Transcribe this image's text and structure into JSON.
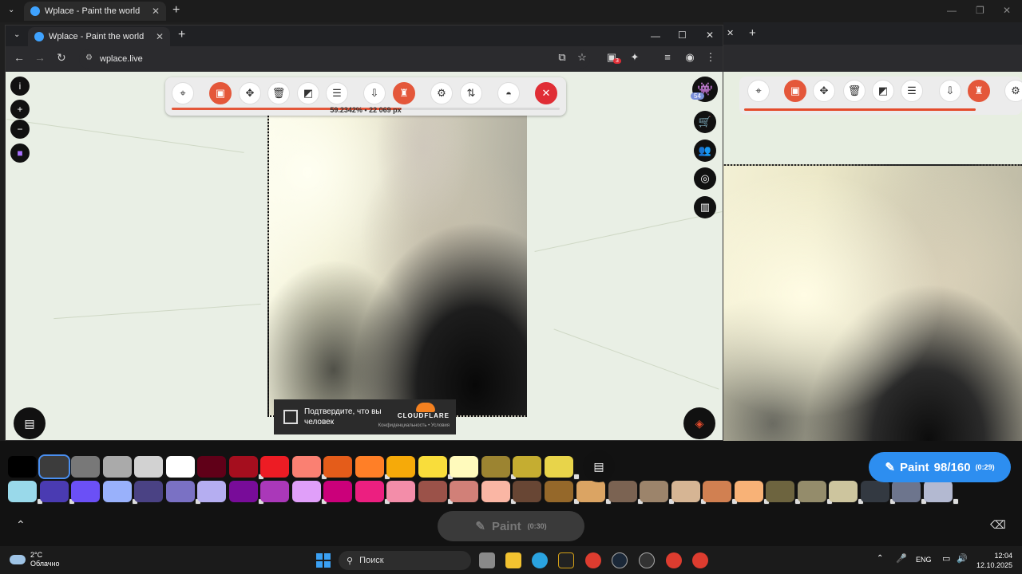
{
  "bg_window": {
    "tab_title": "Wplace - Paint the world",
    "toolbar_tools": [
      "crosshair",
      "image",
      "move",
      "trash",
      "resize",
      "layers",
      "export",
      "bot"
    ],
    "paint_label": "Paint",
    "paint_count": "98/160",
    "paint_timer": "(0:29)"
  },
  "fg_window": {
    "tab_title": "Wplace - Paint the world",
    "url": "wplace.live",
    "extensions_badge": "3",
    "toolbar": {
      "progress_percent": "59.2342%",
      "separator": "•",
      "pixels": "22 069 px",
      "progress_fraction": 0.592342
    },
    "avatar_badge": "54",
    "captcha": {
      "text": "Подтвердите, что вы человек",
      "brand": "CLOUDFLARE",
      "links": "Конфиденциальность • Условия"
    }
  },
  "paint_dim": {
    "label": "Paint",
    "timer": "(0:30)"
  },
  "palette_row1": [
    "#000000",
    "#3c3c3c",
    "#787878",
    "#aaaaaa",
    "#d2d2d2",
    "#ffffff",
    "#600018",
    "#a50e1e",
    "#ed1c24",
    "#fa8072",
    "#e45c1a",
    "#ff7f27",
    "#f6aa09",
    "#f9dd3b",
    "#fffabc",
    "#9c8431",
    "#c5ad31",
    "#e8d44a"
  ],
  "palette_row2": [
    "#99d9ea",
    "#4a3bb2",
    "#6b50f6",
    "#99b1fb",
    "#4a4284",
    "#7a71c4",
    "#b5aef1",
    "#780c99",
    "#aa38b9",
    "#e09ff9",
    "#cb007a",
    "#ec1f80",
    "#f38da9",
    "#9b5249",
    "#d18078",
    "#fab6a4",
    "#684634",
    "#95682a"
  ],
  "palette_row2_right": [
    "#dba463",
    "#7b6352",
    "#9c846b",
    "#d6b594",
    "#d18051",
    "#f8b277",
    "#6d643f",
    "#948c6b",
    "#cdc59e",
    "#333941",
    "#6d758d",
    "#b3b9d1"
  ],
  "taskbar": {
    "weather_temp": "2°C",
    "weather_desc": "Облачно",
    "search_placeholder": "Поиск",
    "language": "ENG",
    "time": "12:04",
    "date": "12.10.2025"
  },
  "colors": {
    "accent_red": "#e4573a",
    "paint_blue": "#2d8ef0",
    "close_red": "#e02d35"
  }
}
